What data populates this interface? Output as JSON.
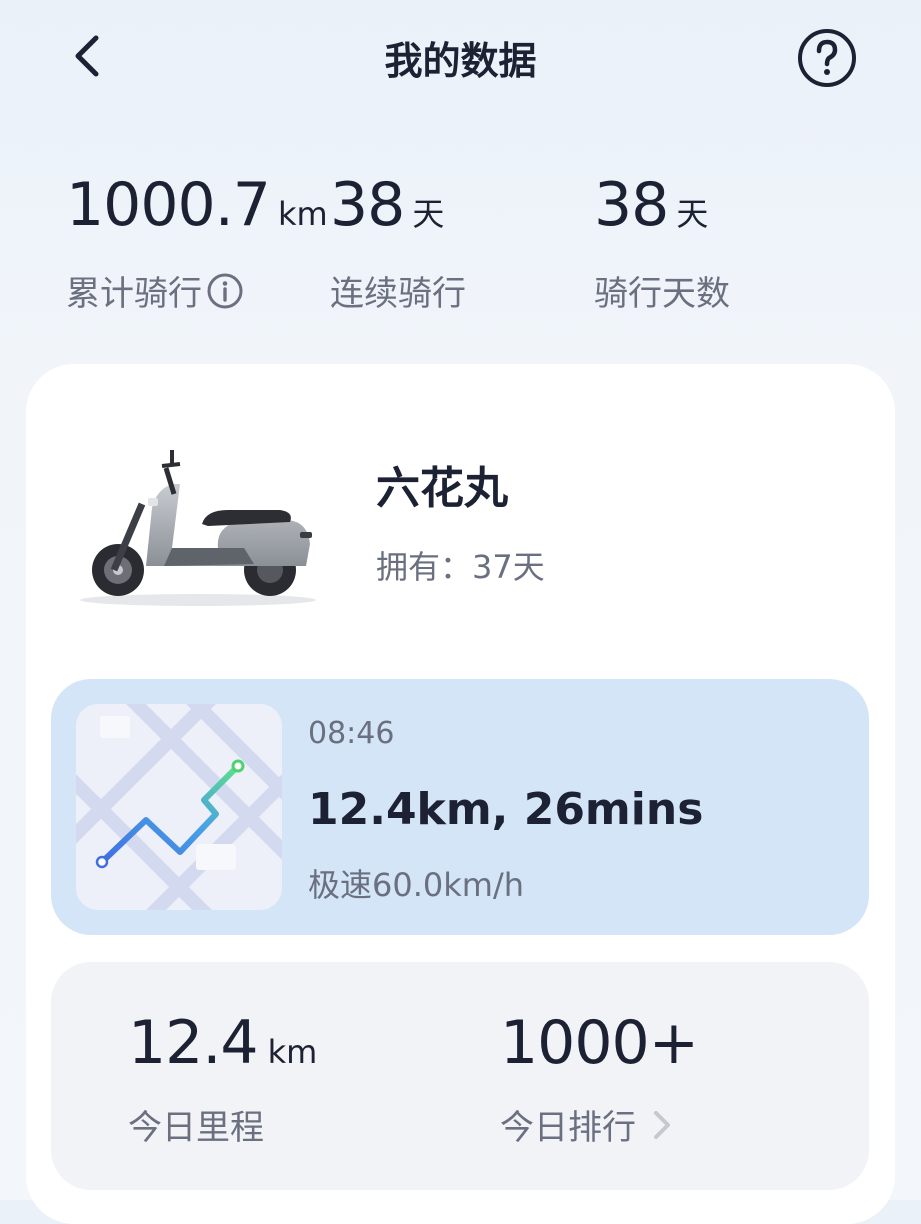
{
  "header": {
    "title": "我的数据"
  },
  "stats": [
    {
      "value": "1000.7",
      "unit": "km",
      "label": "累计骑行",
      "has_info": true
    },
    {
      "value": "38",
      "unit": "天",
      "label": "连续骑行"
    },
    {
      "value": "38",
      "unit": "天",
      "label": "骑行天数"
    }
  ],
  "vehicle": {
    "name": "六花丸",
    "owned": "拥有：37天"
  },
  "ride": {
    "time": "08:46",
    "summary": "12.4km, 26mins",
    "max_speed": "极速60.0km/h"
  },
  "today": {
    "mileage": {
      "value": "12.4",
      "unit": "km",
      "label": "今日里程"
    },
    "rank": {
      "value": "1000+",
      "label": "今日排行"
    }
  },
  "colors": {
    "ride_card_bg": "#d3e5f7",
    "text_primary": "#1c2133",
    "text_secondary": "#6b7080"
  },
  "icons": [
    "back-arrow-icon",
    "help-icon",
    "info-icon",
    "chevron-right-icon"
  ]
}
